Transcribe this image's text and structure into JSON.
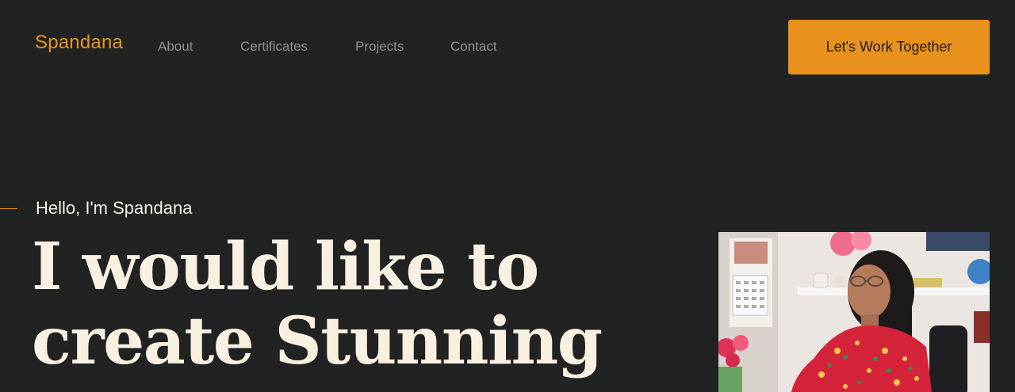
{
  "header": {
    "logo": "Spandana",
    "nav": [
      "About",
      "Certificates",
      "Projects",
      "Contact"
    ],
    "cta_label": "Let's Work Together"
  },
  "hero": {
    "intro": "Hello, I'm Spandana",
    "headline": "I would like to create Stunning"
  },
  "colors": {
    "background": "#202321",
    "accent": "#e8921d",
    "headline": "#f8f1e2",
    "nav_text": "#8c918c"
  }
}
